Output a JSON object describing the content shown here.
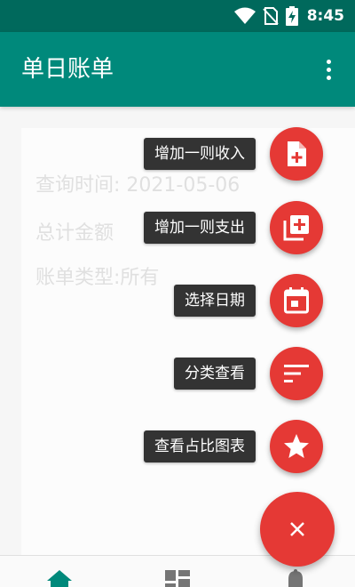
{
  "status_bar": {
    "time": "8:45"
  },
  "app_bar": {
    "title": "单日账单"
  },
  "content": {
    "query_time": "查询时间: 2021-05-06",
    "total_amount": "总计金额",
    "bill_type": "账单类型:所有"
  },
  "fab_menu": {
    "items": [
      {
        "label": "增加一则收入",
        "icon": "note-add-icon"
      },
      {
        "label": "增加一则支出",
        "icon": "library-add-icon"
      },
      {
        "label": "选择日期",
        "icon": "calendar-icon"
      },
      {
        "label": "分类查看",
        "icon": "sort-icon"
      },
      {
        "label": "查看占比图表",
        "icon": "star-icon"
      }
    ],
    "main_icon": "close-icon"
  },
  "bottom_nav": {
    "items": [
      "home-icon",
      "dashboard-icon",
      "notifications-icon"
    ]
  },
  "colors": {
    "status_bar": "#00695c",
    "app_bar": "#00897b",
    "fab": "#e53935",
    "label_bg": "#333333"
  }
}
